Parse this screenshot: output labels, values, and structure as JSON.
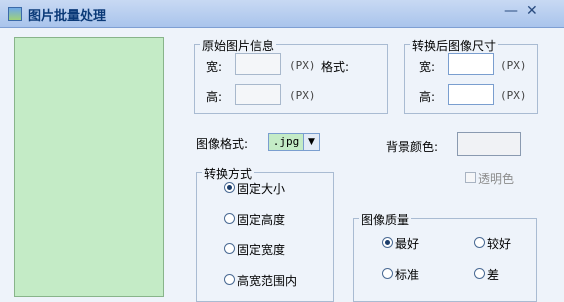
{
  "window": {
    "title": "图片批量处理",
    "minimize_glyph": "—",
    "close_glyph": "✕",
    "icon": "picture-icon"
  },
  "original_info": {
    "legend": "原始图片信息",
    "width_label": "宽:",
    "height_label": "高:",
    "format_label": "格式:",
    "unit": "(PX)",
    "width_value": "",
    "height_value": ""
  },
  "target_size": {
    "legend": "转换后图像尺寸",
    "width_label": "宽:",
    "height_label": "高:",
    "unit": "(PX)",
    "width_value": "",
    "height_value": ""
  },
  "image_format": {
    "label": "图像格式:",
    "selected": ".jpg"
  },
  "background": {
    "label": "背景颜色:",
    "transparent_label": "透明色",
    "transparent_checked": false
  },
  "convert_mode": {
    "legend": "转换方式",
    "options": [
      "固定大小",
      "固定高度",
      "固定宽度",
      "高宽范围内"
    ],
    "selected_index": 0
  },
  "quality": {
    "legend": "图像质量",
    "options": [
      "最好",
      "较好",
      "标准",
      "差"
    ],
    "selected_index": 0
  }
}
